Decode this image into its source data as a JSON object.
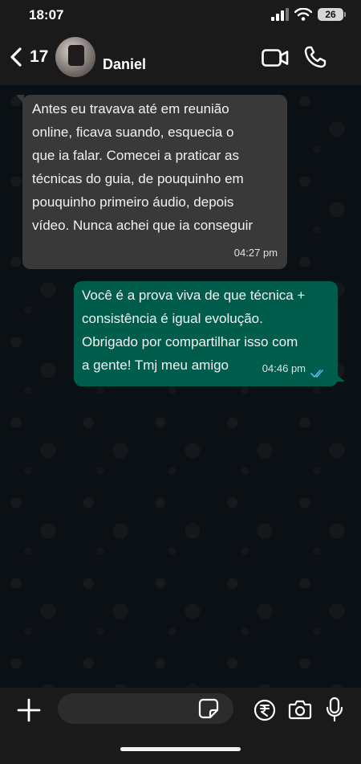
{
  "status_bar": {
    "time": "18:07",
    "battery": "26",
    "icons": [
      "signal-icon",
      "wifi-icon",
      "battery-icon"
    ]
  },
  "header": {
    "back_count": "17",
    "contact_name": "Daniel",
    "icons": [
      "back-icon",
      "video-call-icon",
      "phone-icon"
    ]
  },
  "messages": [
    {
      "direction": "incoming",
      "text": " Antes eu travava até em reunião\nonline, ficava suando, esquecia o\nque ia falar. Comecei a praticar as\ntécnicas do guia, de pouquinho em\npouquinho primeiro áudio, depois\nvídeo. Nunca achei que ia conseguir",
      "time": "04:27 pm"
    },
    {
      "direction": "outgoing",
      "text": " Você é a prova viva de que técnica +\nconsistência é igual evolução.\nObrigado por compartilhar isso com\na gente! Tmj meu amigo",
      "time": "04:46 pm",
      "status": "read"
    }
  ],
  "composer": {
    "placeholder": "",
    "icons": [
      "plus-icon",
      "sticker-icon",
      "rupee-icon",
      "camera-icon",
      "mic-icon"
    ]
  },
  "colors": {
    "incoming_bubble": "#393939",
    "outgoing_bubble": "#005c4b",
    "read_ticks": "#53bdeb",
    "bars": "#1a1a1a"
  }
}
